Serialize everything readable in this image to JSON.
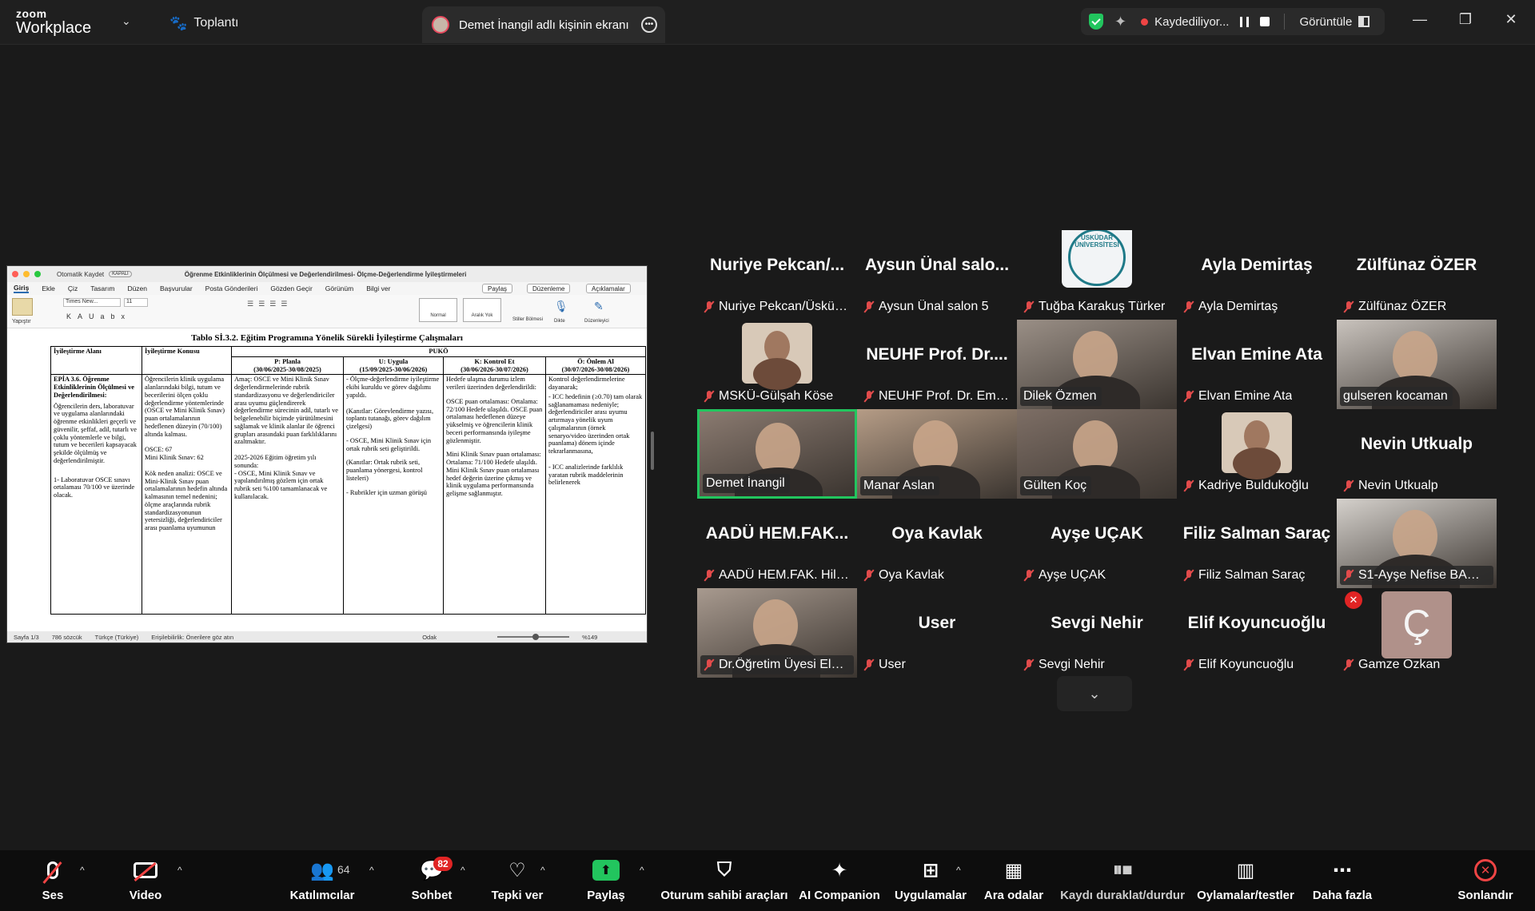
{
  "app": {
    "logo_line1": "zoom",
    "logo_line2": "Workplace"
  },
  "topbar": {
    "meeting_label": "Toplantı",
    "share_tab_label": "Demet İnangil adlı kişinin ekranı",
    "recording_label": "Kaydediliyor...",
    "view_label": "Görüntüle"
  },
  "word": {
    "title_bar": "Otomatik Kaydet",
    "autosave_state": "KAPALI",
    "doc_name": "Öğrenme Etkinliklerinin Ölçülmesi ve Değerlendirilmesi- Ölçme-Değerlendirme İyileştirmeleri",
    "tabs": [
      "Giriş",
      "Ekle",
      "Çiz",
      "Tasarım",
      "Düzen",
      "Başvurular",
      "Posta Gönderileri",
      "Gözden Geçir",
      "Görünüm"
    ],
    "tell_me": "Bilgi ver",
    "share_btn": "Paylaş",
    "edit_btn": "Düzenleme",
    "comments_btn": "Açıklamalar",
    "font_name": "Times New...",
    "font_size": "11",
    "style_normal": "Normal",
    "style_nospace": "Aralık Yok",
    "paste_label": "Yapıştır",
    "styles_label": "Stiller Bölmesi",
    "dictate_label": "Dikte",
    "editor_label": "Düzenleyici",
    "status": {
      "page": "Sayfa 1/3",
      "words": "786 sözcük",
      "lang": "Türkçe (Türkiye)",
      "access": "Erişilebilirlik: Önerilere göz atın",
      "focus": "Odak",
      "zoom": "%149"
    },
    "doc": {
      "heading": "Tablo Sİ.3.2. Eğitim Programına Yönelik Sürekli İyileştirme Çalışmaları",
      "col_area": "İyileştirme Alanı",
      "col_topic": "İyileştirme Konusu",
      "puko": "PUKÖ",
      "col_p": "P: Planla",
      "col_p_date": "(30/06/2025-30/08/2025)",
      "col_u": "U: Uygula",
      "col_u_date": "(15/09/2025-30/06/2026)",
      "col_k": "K: Kontrol Et",
      "col_k_date": "(30/06/2026-30/07/2026)",
      "col_o": "Ö: Önlem Al",
      "col_o_date": "(30/07/2026-30/08/2026)",
      "c1_head": "EPİA 3.6. Öğrenme Etkinliklerinin Ölçülmesi ve Değerlendirilmesi:",
      "c1_body": "Öğrencilerin ders, laboratuvar ve uygulama alanlarındaki öğrenme etkinlikleri geçerli ve güvenilir, şeffaf, adil, tutarlı ve çoklu yöntemlerle ve bilgi, tutum ve becerileri kapsayacak şekilde ölçülmüş ve değerlendirilmiştir.",
      "c1_item": "1- Laboratuvar OSCE sınavı ortalaması 70/100 ve üzerinde olacak.",
      "c2_body": "Öğrencilerin klinik uygulama alanlarındaki bilgi, tutum ve becerilerini ölçen çoklu değerlendirme yöntemlerinde (OSCE ve Mini Klinik Sınav) puan ortalamalarının hedeflenen düzeyin (70/100) altında kalması.",
      "c2_osce": "OSCE: 67",
      "c2_mini": "Mini Klinik Sınav: 62",
      "c2_cause": "Kök neden analizi: OSCE ve Mini-Klinik Sınav puan ortalamalarının hedefin altında kalmasının temel nedenini; ölçme araçlarında rubrik standardizasyonunun yetersizliği, değerlendiriciler arası puanlama uyumunun",
      "c3_body": "Amaç: OSCE ve Mini Klinik Sınav değerlendirmelerinde rubrik standardizasyonu ve değerlendiriciler arası uyumu güçlendirerek değerlendirme sürecinin adil, tutarlı ve belgelenebilir biçimde yürütülmesini sağlamak ve klinik alanlar ile öğrenci grupları arasındaki puan farklılıklarını azaltmaktır.",
      "c3_year": "2025-2026 Eğitim öğretim yılı sonunda:",
      "c3_item": "- OSCE, Mini Klinik Sınav ve yapılandırılmış gözlem için ortak rubrik seti %100 tamamlanacak ve kullanılacak.",
      "c4_item1": "- Ölçme-değerlendirme iyileştirme ekibi kuruldu ve görev dağılımı yapıldı.",
      "c4_ev1": "(Kanıtlar: Görevlendirme yazısı, toplantı tutanağı, görev dağılım çizelgesi)",
      "c4_item2": "- OSCE, Mini Klinik Sınav için ortak rubrik seti geliştirildi.",
      "c4_ev2": "(Kanıtlar: Ortak rubrik seti, puanlama yönergesi, kontrol listeleri)",
      "c4_item3": "- Rubrikler için uzman görüşü",
      "c5_intro": "Hedefe ulaşma durumu izlem verileri üzerinden değerlendirildi:",
      "c5_osce": "OSCE puan ortalaması: Ortalama: 72/100 Hedefe ulaşıldı. OSCE puan ortalaması hedeflenen düzeye yükselmiş ve öğrencilerin klinik beceri performansında iyileşme gözlenmiştir.",
      "c5_mini": "Mini Klinik Sınav puan ortalaması: Ortalama: 71/100 Hedefe ulaşıldı. Mini Klinik Sınav puan ortalaması hedef değerin üzerine çıkmış ve klinik uygulama performansında gelişme sağlanmıştır.",
      "c6_intro": "Kontrol değerlendirmelerine dayanarak;",
      "c6_item1": "- ICC hedefinin (≥0.70) tam olarak sağlanamaması nedeniyle; değerlendiriciler arası uyumu artırmaya yönelik uyum çalışmalarının (örnek senaryo/video üzerinden ortak puanlama) dönem içinde tekrarlanmasına,",
      "c6_item2": "- ICC analizlerinde farklılık yaratan rubrik maddelerinin belirlenerek"
    }
  },
  "gallery": [
    {
      "big": "Nuriye  Pekcan/...",
      "name": "Nuriye Pekcan/Üsküda..."
    },
    {
      "big": "Aysun Ünal salo...",
      "name": "Aysun Ünal salon 5"
    },
    {
      "big": "",
      "name": "Tuğba Karakuş Türker"
    },
    {
      "big": "Ayla Demirtaş",
      "name": "Ayla Demirtaş"
    },
    {
      "big": "Zülfünaz ÖZER",
      "name": "Zülfünaz ÖZER"
    },
    {
      "big": "",
      "name": "MSKÜ-Gülşah Köse"
    },
    {
      "big": "NEUHF Prof. Dr....",
      "name": "NEUHF Prof. Dr. Emel ..."
    },
    {
      "big": "",
      "name": "Dilek Özmen"
    },
    {
      "big": "Elvan Emine Ata",
      "name": "Elvan Emine Ata"
    },
    {
      "big": "",
      "name": "gulseren kocaman"
    },
    {
      "big": "",
      "name": "Demet İnangil"
    },
    {
      "big": "",
      "name": "Manar Aslan"
    },
    {
      "big": "",
      "name": "Gülten Koç"
    },
    {
      "big": "",
      "name": "Kadriye Buldukoğlu"
    },
    {
      "big": "Nevin Utkualp",
      "name": "Nevin Utkualp"
    },
    {
      "big": "AADÜ  HEM.FAK...",
      "name": "AADÜ HEM.FAK. Hilmi..."
    },
    {
      "big": "Oya Kavlak",
      "name": "Oya Kavlak"
    },
    {
      "big": "Ayşe UÇAK",
      "name": "Ayşe UÇAK"
    },
    {
      "big": "Filiz Salman Saraç",
      "name": "Filiz Salman Saraç"
    },
    {
      "big": "",
      "name": "S1-Ayşe Nefise BAHÇE..."
    },
    {
      "big": "",
      "name": "Dr.Öğretim Üyesi Ela Y..."
    },
    {
      "big": "User",
      "name": "User"
    },
    {
      "big": "Sevgi Nehir",
      "name": "Sevgi Nehir"
    },
    {
      "big": "Elif Koyuncuoğlu",
      "name": "Elif Koyuncuoğlu"
    },
    {
      "big": "",
      "name": "Gamze Ozkan"
    }
  ],
  "avatar_letter": "Ç",
  "uskudar_logo_text": "ÜSKÜDAR ÜNİVERSİTESİ",
  "toolbar": {
    "audio": "Ses",
    "video": "Video",
    "participants": "Katılımcılar",
    "participants_count": "64",
    "chat": "Sohbet",
    "chat_badge": "82",
    "react": "Tepki ver",
    "share": "Paylaş",
    "host_tools": "Oturum sahibi araçları",
    "ai": "AI Companion",
    "apps": "Uygulamalar",
    "breakout": "Ara odalar",
    "record": "Kaydı duraklat/durdur",
    "polls": "Oylamalar/testler",
    "more": "Daha fazla",
    "end": "Sonlandır"
  },
  "colors": {
    "accent_green": "#22c55e",
    "muted_red": "#e24b4b",
    "end_red": "#ef4444",
    "bg": "#1a1a1a"
  }
}
